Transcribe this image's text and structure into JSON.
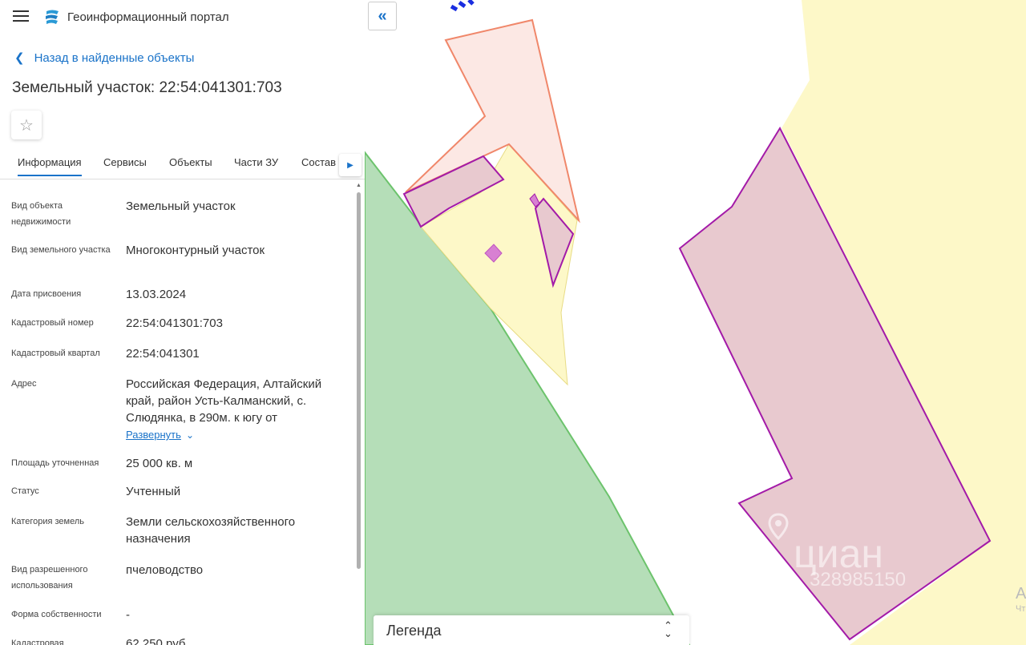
{
  "header": {
    "menu_icon": "hamburger-menu-icon",
    "logo_icon": "portal-logo-icon",
    "title": "Геоинформационный портал"
  },
  "nav": {
    "back_label": "Назад в найденные объекты"
  },
  "object": {
    "title": "Земельный участок: 22:54:041301:703"
  },
  "tabs": [
    {
      "label": "Информация"
    },
    {
      "label": "Сервисы"
    },
    {
      "label": "Объекты"
    },
    {
      "label": "Части ЗУ"
    },
    {
      "label": "Состав"
    }
  ],
  "properties": [
    {
      "label": "Вид объекта недвижимости",
      "value": "Земельный участок"
    },
    {
      "label": "Вид земельного участка",
      "value": "Многоконтурный участок"
    },
    {
      "label": "Дата присвоения",
      "value": "13.03.2024"
    },
    {
      "label": "Кадастровый номер",
      "value": "22:54:041301:703"
    },
    {
      "label": "Кадастровый квартал",
      "value": "22:54:041301"
    },
    {
      "label": "Адрес",
      "value": "Российская Федерация, Алтайский край, район Усть-Калманский, с. Слюдянка, в 290м. к югу от"
    },
    {
      "label": "Площадь уточненная",
      "value": "25 000 кв. м"
    },
    {
      "label": "Статус",
      "value": "Учтенный"
    },
    {
      "label": "Категория земель",
      "value": "Земли сельскохозяйственного назначения"
    },
    {
      "label": "Вид разрешенного использования",
      "value": "пчеловодство"
    },
    {
      "label": "Форма собственности",
      "value": "-"
    },
    {
      "label": "Кадастровая",
      "value": "62 250 руб"
    }
  ],
  "expand_label": "Развернуть",
  "legend": {
    "title": "Легенда"
  },
  "watermark": {
    "brand": "циан",
    "phone": "328985150"
  },
  "map_edge_text": {
    "a": "А",
    "b": "Чт"
  },
  "colors": {
    "accent": "#1a73c9",
    "parcel_fill": "#e8c9cf",
    "parcel_stroke": "#a31aa8",
    "green_zone": "#b5deb8",
    "yellow_zone": "#fdf8c8",
    "orange_stroke": "#f0876a"
  }
}
